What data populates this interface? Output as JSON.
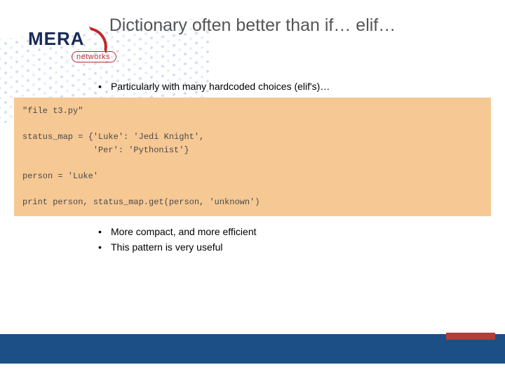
{
  "logo": {
    "main": "MERA",
    "sub": "networks"
  },
  "title": "Dictionary often better than if… elif…",
  "bullets_top": [
    "Particularly with many hardcoded choices (elif's)…"
  ],
  "code": "\"file t3.py\"\n\nstatus_map = {'Luke': 'Jedi Knight',\n              'Per': 'Pythonist'}\n\nperson = 'Luke'\n\nprint person, status_map.get(person, 'unknown')",
  "bullets_bottom": [
    "More compact, and more efficient",
    "This pattern is very useful"
  ]
}
